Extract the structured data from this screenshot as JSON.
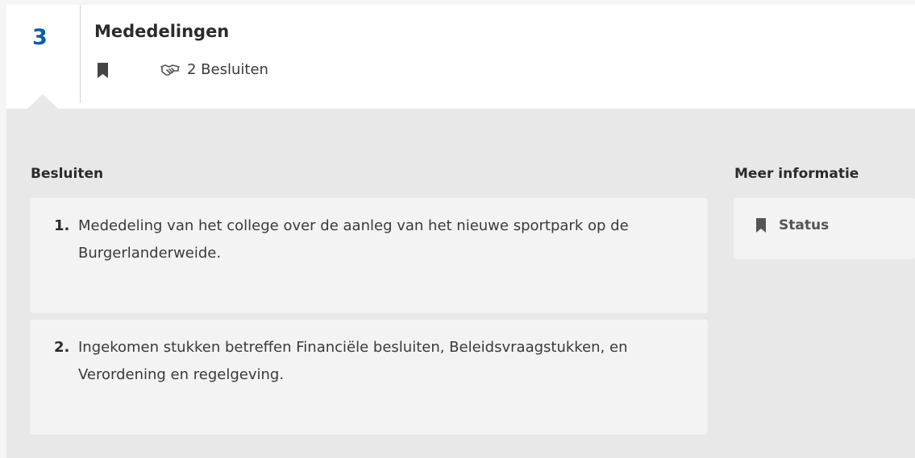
{
  "item": {
    "number": "3",
    "title": "Mededelingen",
    "besluiten_count_label": "2 Besluiten"
  },
  "besluiten": {
    "heading": "Besluiten",
    "items": [
      {
        "number": "1.",
        "text": "Mededeling van het college over de aanleg van het nieuwe sportpark op de Burgerlanderweide."
      },
      {
        "number": "2.",
        "text": "Ingekomen stukken betreffen Financiële besluiten, Beleidsvraagstukken, en Verordening en regelgeving."
      }
    ]
  },
  "meer_informatie": {
    "heading": "Meer informatie",
    "status_label": "Status"
  },
  "icons": {
    "bookmark": "bookmark-icon",
    "handshake": "handshake-icon"
  },
  "colors": {
    "accent": "#0a5ea8",
    "panel_bg": "#e8e8e8",
    "card_bg": "#f3f3f3"
  }
}
